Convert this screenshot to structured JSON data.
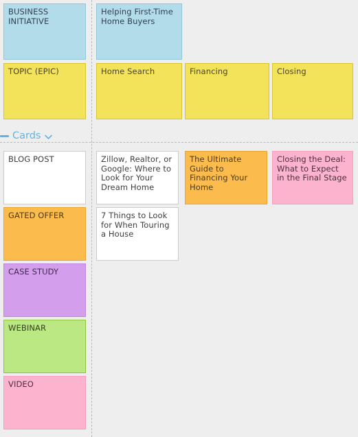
{
  "board": {
    "background_color": "#eeeeee",
    "divider_color": "#b9b9b9"
  },
  "rows": [
    {
      "label_card": {
        "name": "business-initiative-label",
        "text": "BUSINESS INITIATIVE",
        "color": "#b3dcea"
      },
      "cards": [
        {
          "name": "business-initiative-card-1",
          "text": "Helping First-Time Home Buyers",
          "color": "#b3dcea"
        }
      ]
    },
    {
      "label_card": {
        "name": "topic-epic-label",
        "text": "TOPIC (EPIC)",
        "color": "#f3e35b"
      },
      "cards": [
        {
          "name": "topic-card-home-search",
          "text": "Home Search",
          "color": "#f3e35b"
        },
        {
          "name": "topic-card-financing",
          "text": "Financing",
          "color": "#f3e35b"
        },
        {
          "name": "topic-card-closing",
          "text": "Closing",
          "color": "#f3e35b"
        }
      ]
    }
  ],
  "section": {
    "title": "Cards",
    "collapse_icon": "minus-bar-icon",
    "chevron_icon": "chevron-down-icon",
    "accent_color": "#62b3e0"
  },
  "cards_section": {
    "labels": [
      {
        "name": "blog-post-label",
        "text": "BLOG POST",
        "color": "#ffffff"
      },
      {
        "name": "gated-offer-label",
        "text": "GATED OFFER",
        "color": "#fcbc4d"
      },
      {
        "name": "case-study-label",
        "text": "CASE STUDY",
        "color": "#d39eeb"
      },
      {
        "name": "webinar-label",
        "text": "WEBINAR",
        "color": "#bbe882"
      },
      {
        "name": "video-label",
        "text": "VIDEO",
        "color": "#fcb4ce"
      }
    ],
    "content_cards": [
      {
        "name": "card-zillow-realtor-google",
        "text": "Zillow, Realtor, or Google: Where to Look for Your Dream Home",
        "color": "#ffffff"
      },
      {
        "name": "card-7-things-touring",
        "text": "7 Things to Look for When Touring a House",
        "color": "#ffffff"
      },
      {
        "name": "card-ultimate-guide-financing",
        "text": "The Ultimate Guide to Financing Your Home",
        "color": "#fcbc4d"
      },
      {
        "name": "card-closing-the-deal",
        "text": "Closing the Deal: What to Expect in the Final Stage",
        "color": "#fcb4ce"
      }
    ]
  }
}
